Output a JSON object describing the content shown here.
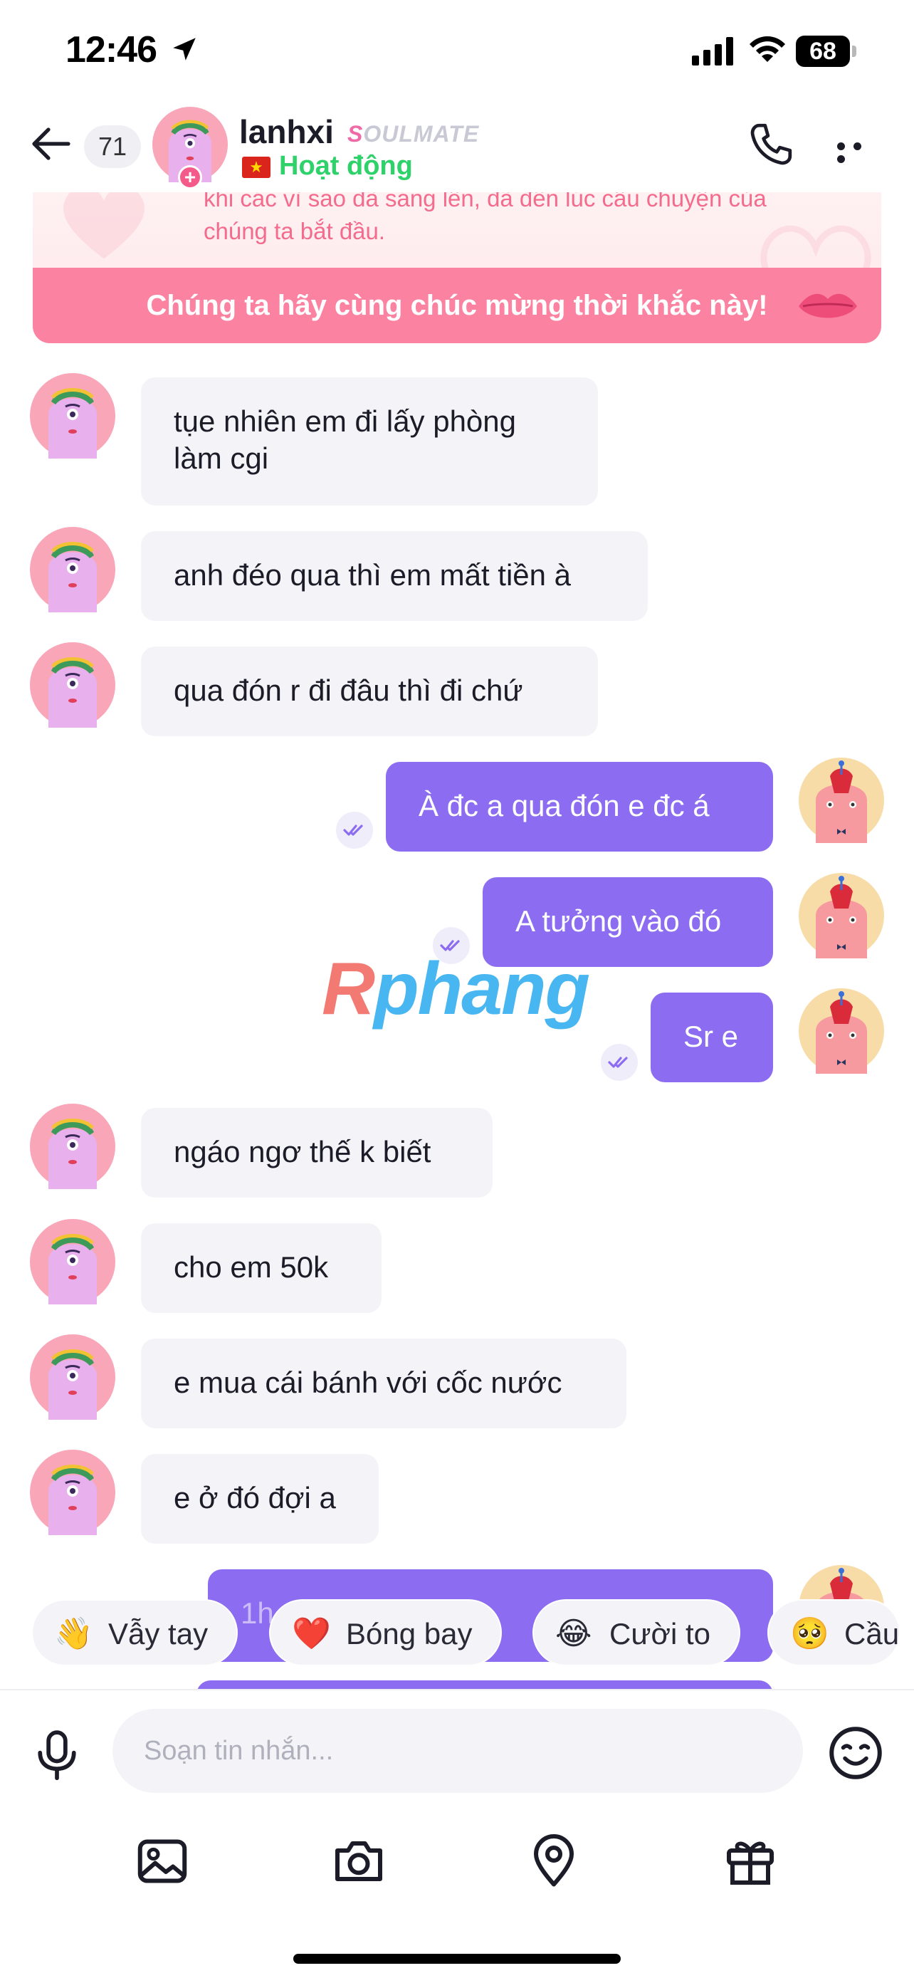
{
  "status_bar": {
    "time": "12:46",
    "battery": "68"
  },
  "header": {
    "back_label": "back",
    "unread_count": "71",
    "name": "lanhxi",
    "tag_first": "S",
    "tag_rest": "OULMATE",
    "status": "Hoạt động",
    "flag": "★"
  },
  "banner": {
    "text": "khi các vì sao đã sáng lên, đã đến lúc câu chuyện của chúng ta bắt đầu.",
    "bar": "Chúng ta hãy cùng chúc mừng thời khắc này!"
  },
  "messages": [
    {
      "side": "in",
      "text": "tụe nhiên em đi lấy phòng\nlàm cgi"
    },
    {
      "side": "in",
      "text": "anh đéo qua thì em mất tiền à"
    },
    {
      "side": "in",
      "text": "qua đón r đi đâu thì đi chứ"
    },
    {
      "side": "out",
      "text": "À đc a qua đón e đc á"
    },
    {
      "side": "out",
      "text": "A tưởng vào đó"
    },
    {
      "side": "out",
      "text": "Sr e"
    },
    {
      "side": "in",
      "text": "ngáo ngơ thế k biết"
    },
    {
      "side": "in",
      "text": "cho em 50k"
    },
    {
      "side": "in",
      "text": "e mua cái bánh với cốc nước"
    },
    {
      "side": "in",
      "text": "e ở đó đợi a"
    },
    {
      "side": "out",
      "text": "1h ... ... cần ... ..."
    }
  ],
  "watermark": {
    "first": "R",
    "rest": "phang"
  },
  "quick_reactions": [
    {
      "emoji": "👋",
      "label": "Vẫy tay"
    },
    {
      "emoji": "❤️",
      "label": "Bóng bay"
    },
    {
      "emoji": "😂",
      "label": "Cười to"
    },
    {
      "emoji": "🥺",
      "label": "Cầu"
    }
  ],
  "composer": {
    "placeholder": "Soạn tin nhắn..."
  },
  "icons": [
    "back-arrow-icon",
    "phone-icon",
    "more-icon",
    "mic-icon",
    "emoji-icon",
    "image-icon",
    "camera-icon",
    "location-icon",
    "gift-icon"
  ],
  "colors": {
    "outgoing": "#8c6cf0",
    "incoming": "#f4f4f8",
    "online": "#2ed16a",
    "banner_bar": "#fb82a0"
  }
}
